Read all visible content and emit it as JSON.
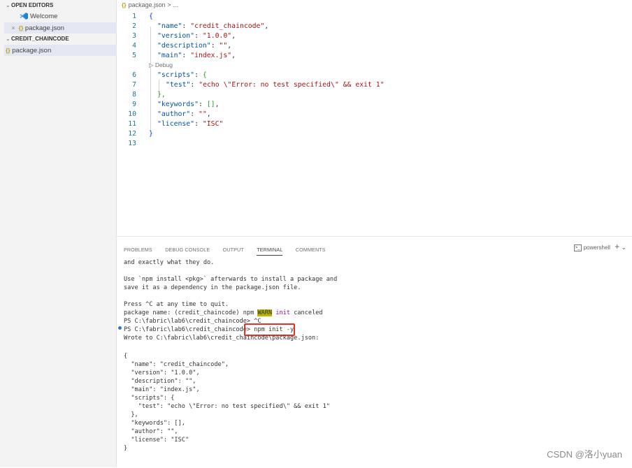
{
  "sidebar": {
    "open_editors_header": "OPEN EDITORS",
    "open_editors": [
      {
        "label": "Welcome",
        "icon": "vscode-icon"
      },
      {
        "label": "package.json",
        "icon": "json-braces-icon",
        "close": "×",
        "braces": "{}"
      }
    ],
    "folder_header": "CREDIT_CHAINCODE",
    "files": [
      {
        "label": "package.json",
        "braces": "{}"
      }
    ]
  },
  "breadcrumb": {
    "braces": "{}",
    "file": "package.json",
    "sep": ">",
    "rest": "..."
  },
  "editor": {
    "debug_lens": "▷ Debug",
    "lines": [
      {
        "n": "1",
        "text": "{"
      },
      {
        "n": "2",
        "key": "\"name\"",
        "value": "\"credit_chaincode\"",
        "tail": ","
      },
      {
        "n": "3",
        "key": "\"version\"",
        "value": "\"1.0.0\"",
        "tail": ","
      },
      {
        "n": "4",
        "key": "\"description\"",
        "value": "\"\"",
        "tail": ","
      },
      {
        "n": "5",
        "key": "\"main\"",
        "value": "\"index.js\"",
        "tail": ","
      },
      {
        "n": "6",
        "key": "\"scripts\"",
        "value": "{",
        "tail": ""
      },
      {
        "n": "7",
        "key": "\"test\"",
        "value": "\"echo \\\"Error: no test specified\\\" && exit 1\"",
        "tail": ""
      },
      {
        "n": "8",
        "text": "},"
      },
      {
        "n": "9",
        "key": "\"keywords\"",
        "value": "[]",
        "tail": ","
      },
      {
        "n": "10",
        "key": "\"author\"",
        "value": "\"\"",
        "tail": ","
      },
      {
        "n": "11",
        "key": "\"license\"",
        "value": "\"ISC\"",
        "tail": ""
      },
      {
        "n": "12",
        "text": "}"
      },
      {
        "n": "13",
        "text": ""
      }
    ]
  },
  "panel": {
    "tabs": [
      "PROBLEMS",
      "DEBUG CONSOLE",
      "OUTPUT",
      "TERMINAL",
      "COMMENTS"
    ],
    "active_tab": "TERMINAL",
    "shell": "powershell",
    "plus": "+",
    "chevron": "⌄",
    "terminal_lines": [
      "and exactly what they do.",
      "",
      "Use `npm install <pkg>` afterwards to install a package and",
      "save it as a dependency in the package.json file.",
      "",
      "Press ^C at any time to quit.",
      "package name: (credit_chaincode) npm ",
      "PS C:\\fabric\\lab6\\credit_chaincode> ^C",
      "PS C:\\fabric\\lab6\\credit_chaincode> ",
      "Wrote to C:\\fabric\\lab6\\credit_chaincode\\package.json:",
      "",
      "{",
      "  \"name\": \"credit_chaincode\",",
      "  \"version\": \"1.0.0\",",
      "  \"description\": \"\",",
      "  \"main\": \"index.js\",",
      "  \"scripts\": {",
      "    \"test\": \"echo \\\"Error: no test specified\\\" && exit 1\"",
      "  },",
      "  \"keywords\": [],",
      "  \"author\": \"\",",
      "  \"license\": \"ISC\"",
      "}"
    ],
    "warn_badge": "WARN",
    "warn_init": "init",
    "warn_rest": " canceled",
    "highlighted_command": "npm init -y"
  },
  "watermark": "CSDN @洛小yuan"
}
